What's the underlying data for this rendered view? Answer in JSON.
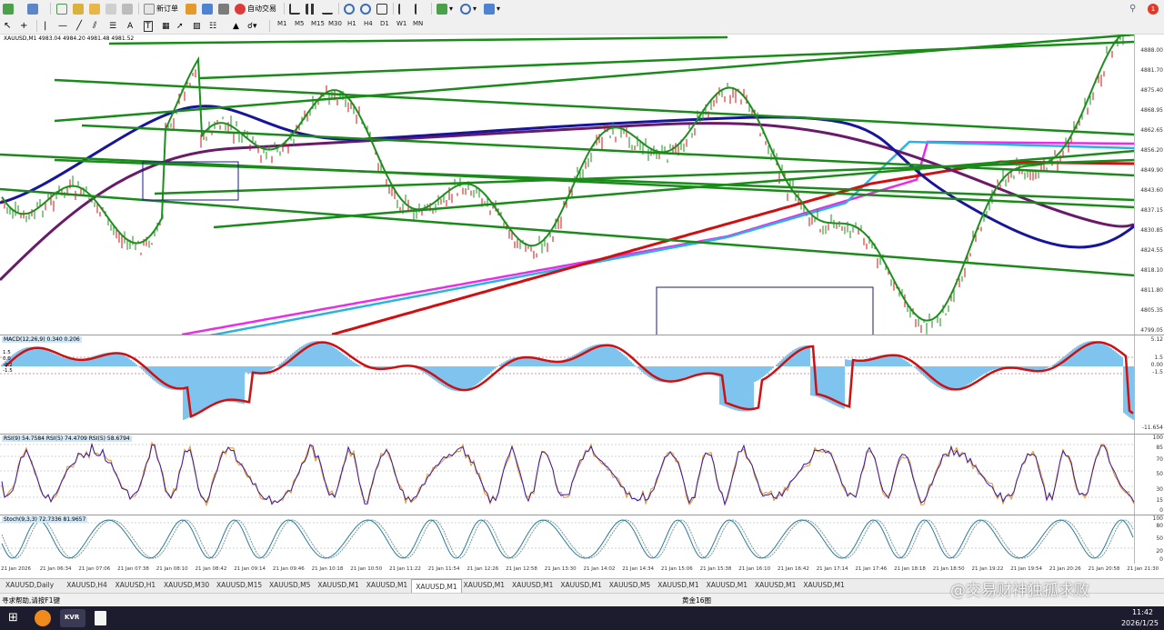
{
  "toolbar": {
    "new_order_label": "新订单",
    "algo_trading_label": "自动交易",
    "timeframes": [
      "M1",
      "M5",
      "M15",
      "M30",
      "H1",
      "H4",
      "D1",
      "W1",
      "MN"
    ],
    "notification_count": "1"
  },
  "chart": {
    "title": "XAUUSD,M1  4983.04 4984.20 4981.48 4981.52",
    "price_ticks": [
      "4888.00",
      "4881.70",
      "4875.40",
      "4868.95",
      "4862.65",
      "4856.20",
      "4849.90",
      "4843.60",
      "4837.15",
      "4830.85",
      "4824.55",
      "4818.10",
      "4811.80",
      "4805.35",
      "4799.05"
    ],
    "macd_label": "MACD(12,26,9) 0.340 0.206",
    "macd_ticks": [
      "5.12",
      "1.5",
      "0.00",
      "-1.5",
      "-11.654"
    ],
    "macd_left_ticks": [
      "1.5",
      "0.0",
      "-0.2",
      "-1.5"
    ],
    "rsi_label": "RSI(9) 54.7584  RSI(5) 74.4709  RSI(5) 58.6794",
    "rsi_ticks": [
      "100",
      "85",
      "70",
      "50",
      "30",
      "15",
      "0"
    ],
    "stoch_label": "Stoch(9,3,3) 72.7336 81.9657",
    "stoch_ticks": [
      "100",
      "80",
      "50",
      "20",
      "0"
    ],
    "time_ticks": [
      "21 Jan 2026",
      "21 Jan 06:34",
      "21 Jan 07:06",
      "21 Jan 07:38",
      "21 Jan 08:10",
      "21 Jan 08:42",
      "21 Jan 09:14",
      "21 Jan 09:46",
      "21 Jan 10:18",
      "21 Jan 10:50",
      "21 Jan 11:22",
      "21 Jan 11:54",
      "21 Jan 12:26",
      "21 Jan 12:58",
      "21 Jan 13:30",
      "21 Jan 14:02",
      "21 Jan 14:34",
      "21 Jan 15:06",
      "21 Jan 15:38",
      "21 Jan 16:10",
      "21 Jan 16:42",
      "21 Jan 17:14",
      "21 Jan 17:46",
      "21 Jan 18:18",
      "21 Jan 18:50",
      "21 Jan 19:22",
      "21 Jan 19:54",
      "21 Jan 20:26",
      "21 Jan 20:58",
      "21 Jan 21:30"
    ]
  },
  "tabs": [
    "XAUUSD,Daily",
    "XAUUSD,H4",
    "XAUUSD,H1",
    "XAUUSD,M30",
    "XAUUSD,M15",
    "XAUUSD,M5",
    "XAUUSD,M1",
    "XAUUSD,M1",
    "XAUUSD,M1",
    "XAUUSD,M1",
    "XAUUSD,M1",
    "XAUUSD,M1",
    "XAUUSD,M5",
    "XAUUSD,M1",
    "XAUUSD,M1",
    "XAUUSD,M1",
    "XAUUSD,M1"
  ],
  "active_tab_index": 8,
  "status": {
    "help": "寻求帮助,请按F1键",
    "profile": "黄金16图"
  },
  "watermark": "@交易财神独孤求败",
  "taskbar": {
    "time": "11:42",
    "date": "2026/1/25",
    "app_label": "KVR"
  },
  "colors": {
    "up_candle": "#d01010",
    "down_candle": "#1e8f1e",
    "trendline": "#1a8a1a",
    "ma_blue": "#17159a",
    "ma_purple": "#6a1a6a",
    "ma_red": "#d01010",
    "ma_magenta": "#ea2bea",
    "ma_cyan": "#2ab4dd",
    "macd_hist": "#7fc4ef",
    "macd_signal": "#d01010"
  }
}
